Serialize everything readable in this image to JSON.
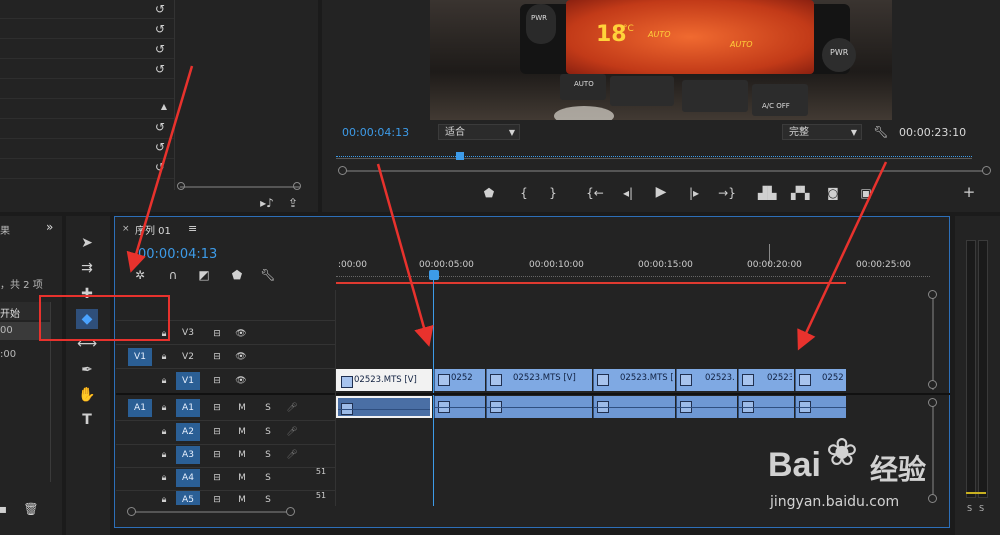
{
  "left_panel": {
    "tab_partial": "果",
    "items_info": "，共 2 项",
    "start_label": "开始",
    "time_row1": "00",
    "time_row2": ":00",
    "expand_label": "»"
  },
  "monitor": {
    "timecode_current": "00:00:04:13",
    "fit_select": "适合",
    "quality_select": "完整",
    "timecode_duration": "00:00:23:10",
    "lcd_temp": "18",
    "lcd_unit": "°C",
    "lcd_auto1": "AUTO",
    "lcd_auto2": "AUTO",
    "btn_pwr_left": "PWR",
    "btn_pwr_right": "PWR",
    "btn_auto": "AUTO",
    "btn_acoff": "A/C OFF"
  },
  "sequence": {
    "title": "序列 01",
    "menu_glyph": "≡",
    "timecode": "00:00:04:13",
    "ruler_labels": [
      ":00:00",
      "00:00:05:00",
      "00:00:10:00",
      "00:00:15:00",
      "00:00:20:00",
      "00:00:25:00"
    ]
  },
  "tracks": {
    "video": [
      {
        "name": "V3",
        "source": ""
      },
      {
        "name": "V2",
        "source": "V1"
      },
      {
        "name": "V1",
        "source": ""
      }
    ],
    "audio": [
      {
        "name": "A1",
        "source": "A1",
        "m": "M",
        "s": "S"
      },
      {
        "name": "A2",
        "source": "",
        "m": "M",
        "s": "S"
      },
      {
        "name": "A3",
        "source": "",
        "m": "M",
        "s": "S"
      },
      {
        "name": "A4",
        "source": "",
        "m": "M",
        "s": "S",
        "ch": "51"
      },
      {
        "name": "A5",
        "source": "",
        "m": "M",
        "s": "S",
        "ch": "51"
      }
    ]
  },
  "clips": {
    "video": [
      "02523.MTS [V]",
      "0252",
      "02523.MTS [V]",
      "02523.MTS [V",
      "02523.",
      "02523.",
      "02523"
    ]
  },
  "meter": {
    "s1": "S",
    "s2": "S"
  },
  "watermark": {
    "brand": "Bai",
    "brand2": "经验",
    "url": "jingyan.baidu.com"
  },
  "colors": {
    "accent": "#3d9be8",
    "clip_video": "#7fa9e3",
    "clip_audio": "#6e98d4",
    "arrow": "#e8322d"
  }
}
